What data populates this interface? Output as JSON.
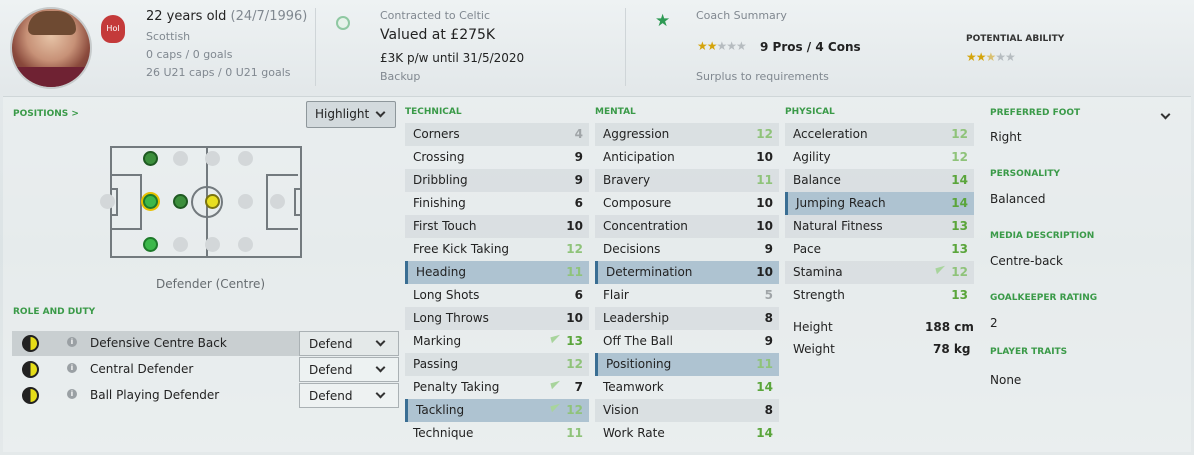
{
  "header": {
    "age": "22 years old",
    "dob": "(24/7/1996)",
    "badge": "Hol",
    "nationality": "Scottish",
    "caps": "0 caps / 0 goals",
    "u21": "26 U21 caps / 0 U21 goals",
    "contract_label": "Contracted to Celtic",
    "value": "Valued at £275K",
    "wage": "£3K p/w until 31/5/2020",
    "squad_status": "Backup",
    "coach_summary_label": "Coach Summary",
    "pros_cons": "9 Pros / 4 Cons",
    "surplus": "Surplus to requirements",
    "potential_label": "POTENTIAL ABILITY",
    "coach_stars": 2,
    "potential_stars": 2.5
  },
  "positions": {
    "title": "POSITIONS >",
    "highlight_label": "Highlight",
    "position_name": "Defender (Centre)"
  },
  "roles": {
    "title": "ROLE AND DUTY",
    "items": [
      {
        "name": "Defensive Centre Back",
        "duty": "Defend"
      },
      {
        "name": "Central Defender",
        "duty": "Defend"
      },
      {
        "name": "Ball Playing Defender",
        "duty": "Defend"
      }
    ]
  },
  "technical": {
    "title": "TECHNICAL",
    "items": [
      {
        "name": "Corners",
        "value": "4"
      },
      {
        "name": "Crossing",
        "value": "9"
      },
      {
        "name": "Dribbling",
        "value": "9"
      },
      {
        "name": "Finishing",
        "value": "6"
      },
      {
        "name": "First Touch",
        "value": "10"
      },
      {
        "name": "Free Kick Taking",
        "value": "12"
      },
      {
        "name": "Heading",
        "value": "11"
      },
      {
        "name": "Long Shots",
        "value": "6"
      },
      {
        "name": "Long Throws",
        "value": "10"
      },
      {
        "name": "Marking",
        "value": "13"
      },
      {
        "name": "Passing",
        "value": "12"
      },
      {
        "name": "Penalty Taking",
        "value": "7"
      },
      {
        "name": "Tackling",
        "value": "12"
      },
      {
        "name": "Technique",
        "value": "11"
      }
    ]
  },
  "mental": {
    "title": "MENTAL",
    "items": [
      {
        "name": "Aggression",
        "value": "12"
      },
      {
        "name": "Anticipation",
        "value": "10"
      },
      {
        "name": "Bravery",
        "value": "11"
      },
      {
        "name": "Composure",
        "value": "10"
      },
      {
        "name": "Concentration",
        "value": "10"
      },
      {
        "name": "Decisions",
        "value": "9"
      },
      {
        "name": "Determination",
        "value": "10"
      },
      {
        "name": "Flair",
        "value": "5"
      },
      {
        "name": "Leadership",
        "value": "8"
      },
      {
        "name": "Off The Ball",
        "value": "9"
      },
      {
        "name": "Positioning",
        "value": "11"
      },
      {
        "name": "Teamwork",
        "value": "14"
      },
      {
        "name": "Vision",
        "value": "8"
      },
      {
        "name": "Work Rate",
        "value": "14"
      }
    ]
  },
  "physical": {
    "title": "PHYSICAL",
    "items": [
      {
        "name": "Acceleration",
        "value": "12"
      },
      {
        "name": "Agility",
        "value": "12"
      },
      {
        "name": "Balance",
        "value": "14"
      },
      {
        "name": "Jumping Reach",
        "value": "14"
      },
      {
        "name": "Natural Fitness",
        "value": "13"
      },
      {
        "name": "Pace",
        "value": "13"
      },
      {
        "name": "Stamina",
        "value": "12"
      },
      {
        "name": "Strength",
        "value": "13"
      }
    ],
    "height_label": "Height",
    "height": "188 cm",
    "weight_label": "Weight",
    "weight": "78 kg"
  },
  "info": {
    "preferred_foot_label": "PREFERRED FOOT",
    "preferred_foot": "Right",
    "personality_label": "PERSONALITY",
    "personality": "Balanced",
    "media_label": "MEDIA DESCRIPTION",
    "media": "Centre-back",
    "gk_label": "GOALKEEPER RATING",
    "gk": "2",
    "traits_label": "PLAYER TRAITS",
    "traits": "None"
  }
}
